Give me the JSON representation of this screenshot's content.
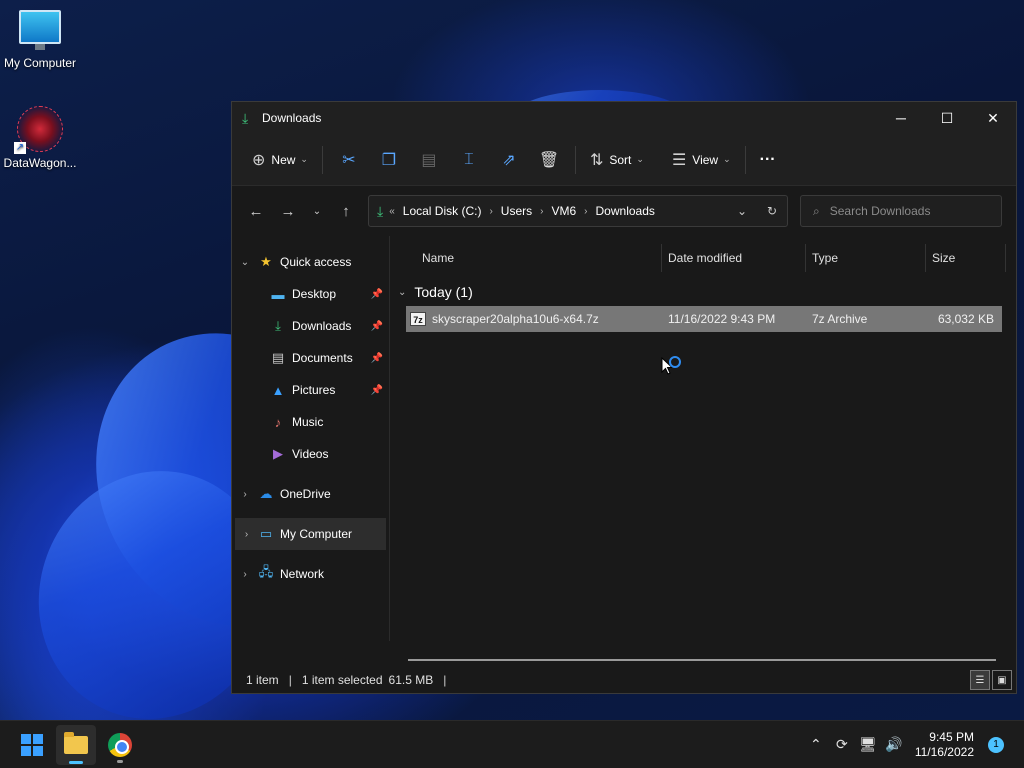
{
  "desktop": {
    "icons": [
      {
        "label": "My Computer"
      },
      {
        "label": "DataWagon..."
      }
    ]
  },
  "window": {
    "title": "Downloads",
    "controls": {
      "minimize": "─",
      "maximize": "☐",
      "close": "✕"
    },
    "toolbar": {
      "new_label": "New",
      "sort_label": "Sort",
      "view_label": "View",
      "more": "···"
    },
    "address": {
      "overflow": "«",
      "crumbs": [
        "Local Disk (C:)",
        "Users",
        "VM6",
        "Downloads"
      ]
    },
    "search": {
      "placeholder": "Search Downloads"
    },
    "sidebar": {
      "quick_access": "Quick access",
      "items": [
        {
          "label": "Desktop"
        },
        {
          "label": "Downloads"
        },
        {
          "label": "Documents"
        },
        {
          "label": "Pictures"
        },
        {
          "label": "Music"
        },
        {
          "label": "Videos"
        }
      ],
      "onedrive": "OneDrive",
      "my_computer": "My Computer",
      "network": "Network"
    },
    "columns": {
      "name": "Name",
      "date": "Date modified",
      "type": "Type",
      "size": "Size"
    },
    "group": {
      "label": "Today (1)"
    },
    "files": [
      {
        "name": "skyscraper20alpha10u6-x64.7z",
        "date": "11/16/2022 9:43 PM",
        "type": "7z Archive",
        "size": "63,032 KB"
      }
    ],
    "status": {
      "count": "1 item",
      "selected": "1 item selected",
      "selected_size": "61.5 MB"
    }
  },
  "taskbar": {
    "time": "9:45 PM",
    "date": "11/16/2022",
    "notifications": "1"
  },
  "colors": {
    "accent": "#4cc2ff",
    "download_green": "#3ec47c",
    "selected_row": "#777777"
  }
}
